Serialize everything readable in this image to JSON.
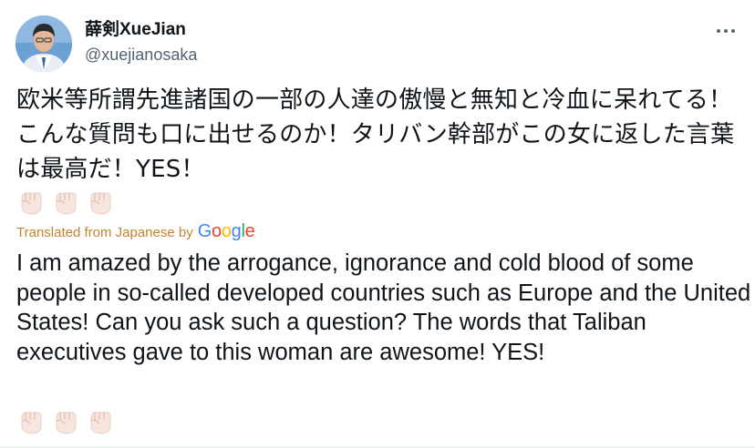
{
  "tweet": {
    "display_name": "薛剣XueJian",
    "handle": "@xuejianosaka",
    "avatar_icon": "profile-photo",
    "more_icon": "more-horizontal-icon",
    "original_text": "欧米等所謂先進諸国の一部の人達の傲慢と無知と冷血に呆れてる！こんな質問も口に出せるのか！タリバン幹部がこの女に返した言葉は最高だ！YES！",
    "fist_emoji_count": 3,
    "translated_label": "Translated from Japanese by",
    "google_logo_letters": [
      "G",
      "o",
      "o",
      "g",
      "l",
      "e"
    ],
    "translated_text": "I am amazed by the arrogance, ignorance and cold blood of some people in so-called developed countries such as Europe and the United States! Can you ask such a question? The words that Taliban executives gave to this woman are awesome! YES!"
  },
  "colors": {
    "name": "#0f1419",
    "handle": "#536471",
    "translated_label": "#c2842f",
    "google_blue": "#4285f4",
    "google_red": "#ea4335",
    "google_yellow": "#fbbc05",
    "google_green": "#34a853"
  }
}
